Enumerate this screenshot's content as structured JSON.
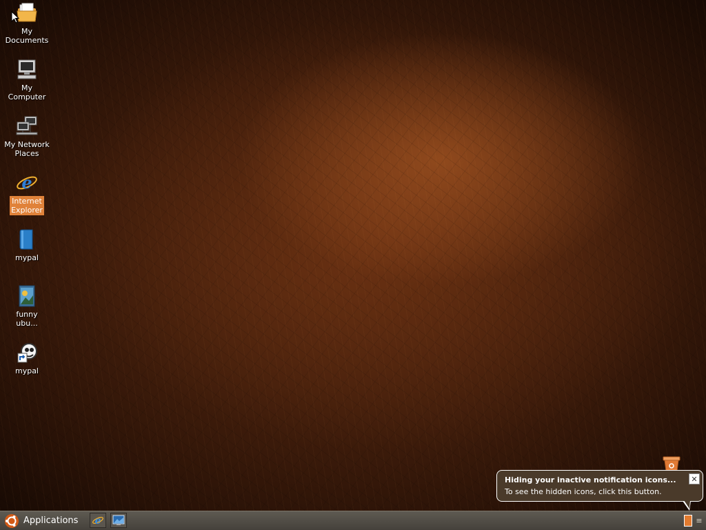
{
  "desktop": {
    "icons": [
      {
        "label": "My\nDocuments",
        "icon": "folder-documents-icon"
      },
      {
        "label": "My\nComputer",
        "icon": "computer-icon"
      },
      {
        "label": "My Network\nPlaces",
        "icon": "network-places-icon"
      },
      {
        "label": "Internet\nExplorer",
        "icon": "internet-explorer-icon",
        "selected": true
      },
      {
        "label": "mypal",
        "icon": "mypal-book-icon"
      },
      {
        "label": "funny\nubu...",
        "icon": "image-file-icon"
      },
      {
        "label": "mypal",
        "icon": "mypal-shortcut-icon"
      }
    ],
    "trash_icon": "recycle-bin-icon"
  },
  "notification": {
    "title": "Hiding your inactive notification icons...",
    "text": "To see the hidden icons, click this button.",
    "close_label": "✕"
  },
  "taskbar": {
    "start_label": "Applications",
    "start_icon": "ubuntu-logo-icon",
    "quick_launch": [
      {
        "icon": "internet-explorer-icon"
      },
      {
        "icon": "show-desktop-icon"
      }
    ],
    "tray_icon": "tray-notification-icon",
    "tray_expand_label": "≡"
  },
  "colors": {
    "selection": "#e0823a",
    "taskbar": "#4f4b44",
    "balloon": "#4a3a2a"
  }
}
